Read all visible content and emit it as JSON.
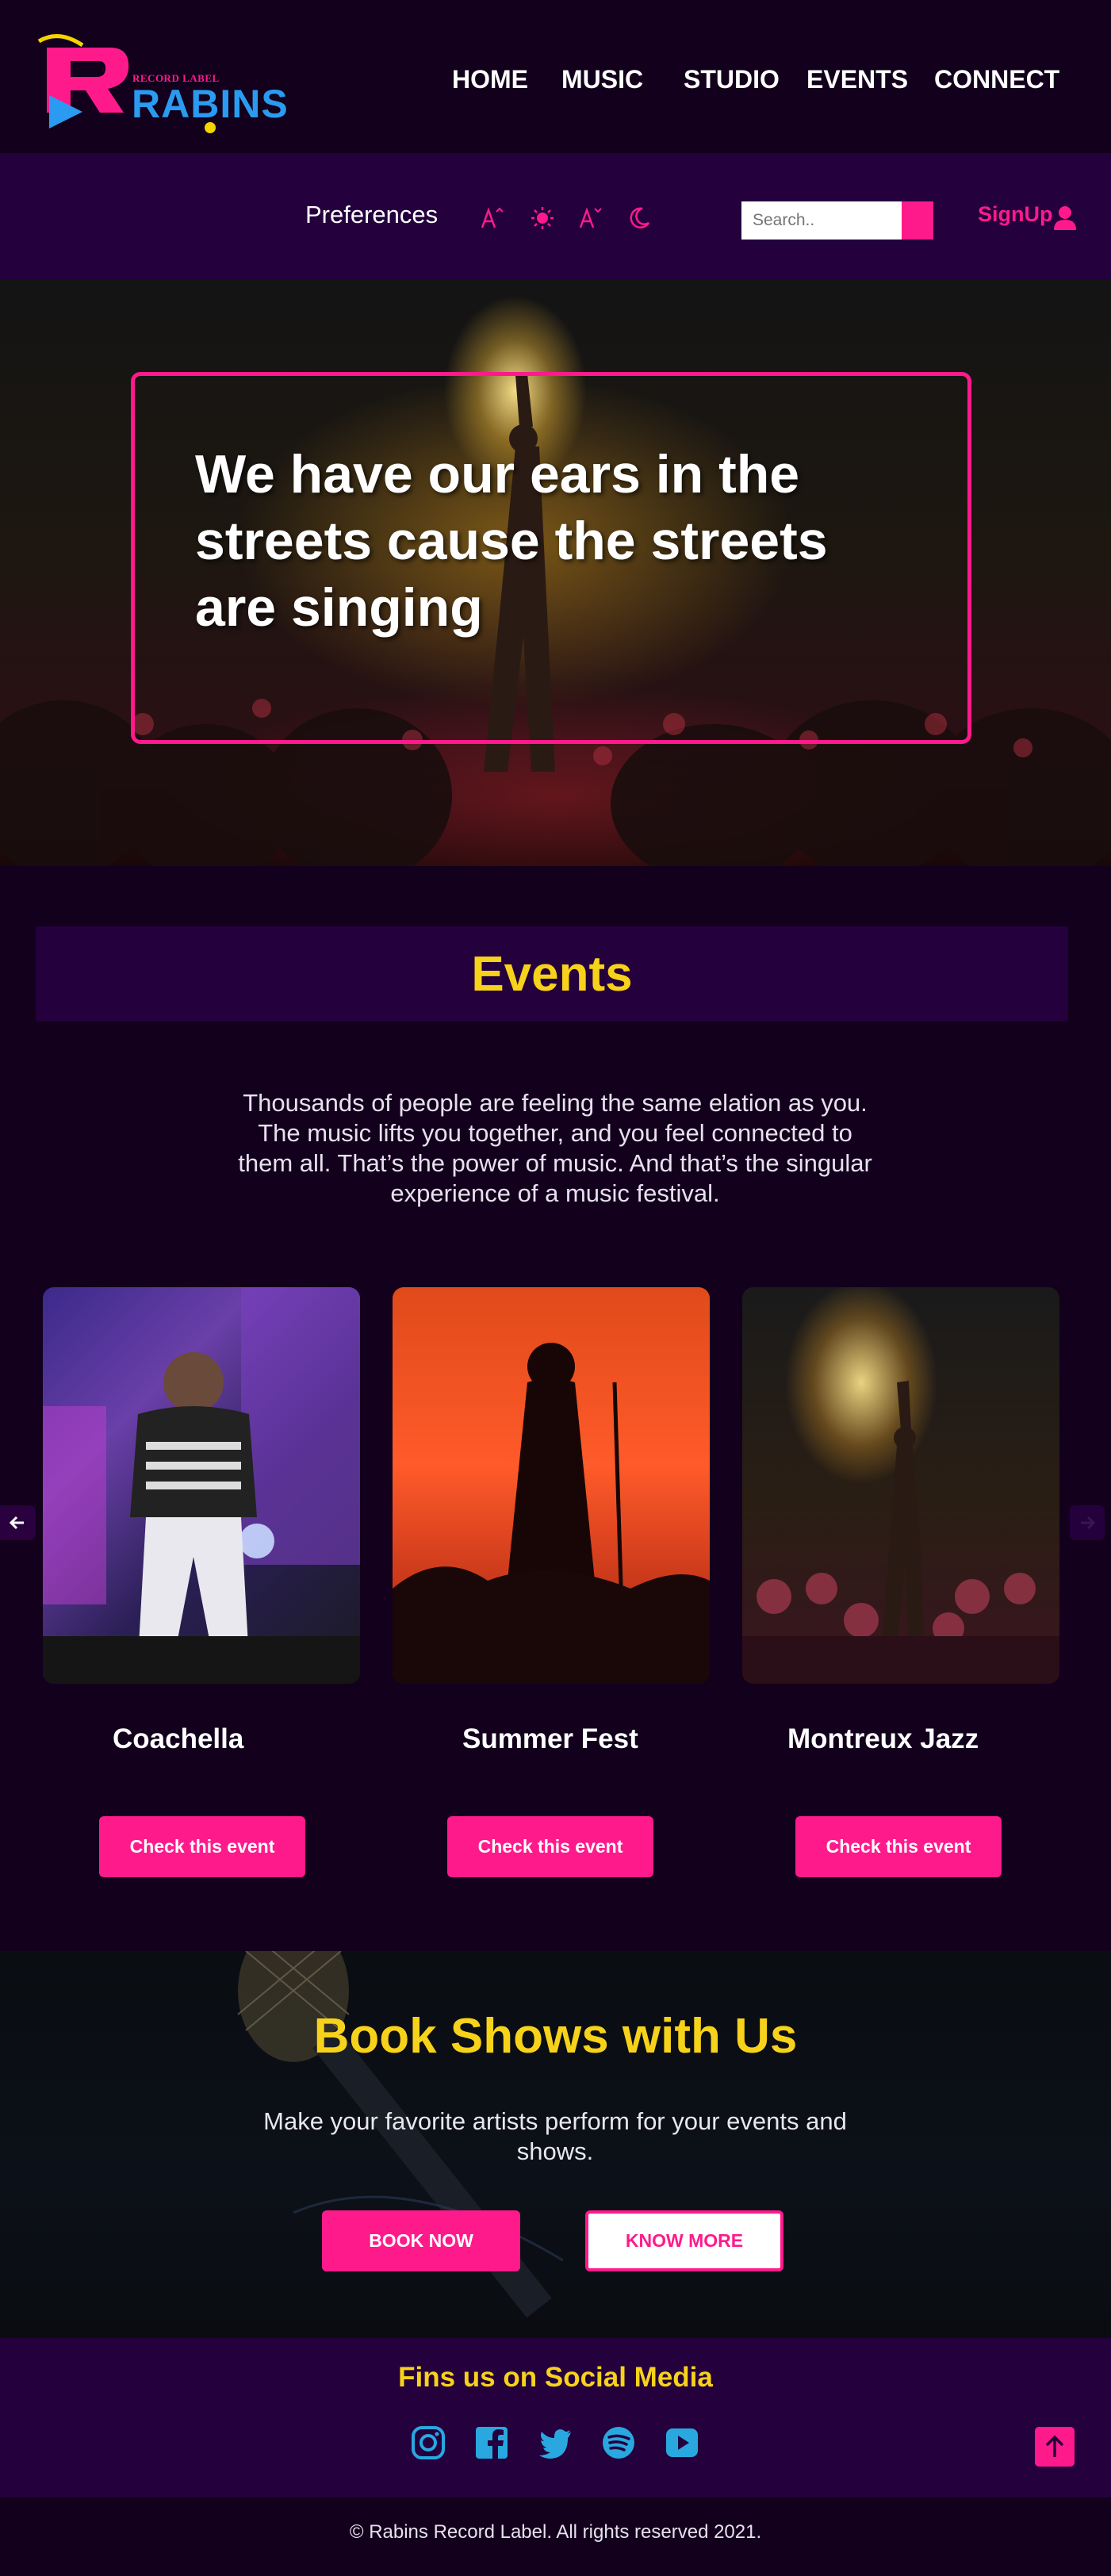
{
  "logo": {
    "small_text": "RECORD LABEL",
    "big_text": "RABINS"
  },
  "nav": {
    "items": [
      "HOME",
      "MUSIC",
      "STUDIO",
      "EVENTS",
      "CONNECT"
    ]
  },
  "preferences": {
    "label": "Preferences",
    "icons": [
      "font-increase-icon",
      "brightness-icon",
      "font-decrease-icon",
      "dark-mode-icon"
    ],
    "search_placeholder": "Search..",
    "signup_label": "SignUp"
  },
  "hero": {
    "title": "We have our ears in the streets cause the streets are singing"
  },
  "events": {
    "title": "Events",
    "description": "Thousands of people are feeling the same elation as you. The music lifts you together, and you feel connected to them all. That’s the power of music. And that’s the singular experience of a music festival.",
    "cards": [
      {
        "title": "Coachella",
        "button": "Check this event"
      },
      {
        "title": "Summer Fest",
        "button": "Check this event"
      },
      {
        "title": "Montreux Jazz",
        "button": "Check this event"
      }
    ]
  },
  "book": {
    "title": "Book Shows with Us",
    "description": "Make your favorite artists perform for your events and shows.",
    "book_button": "BOOK NOW",
    "know_button": "KNOW MORE"
  },
  "social": {
    "title": "Fins us on Social Media",
    "icons": [
      "instagram-icon",
      "facebook-icon",
      "twitter-icon",
      "spotify-icon",
      "youtube-icon"
    ]
  },
  "footer": {
    "copyright": "© Rabins Record Label. All rights reserved 2021."
  },
  "colors": {
    "accent": "#ff1a8c",
    "heading": "#f7d21a",
    "background": "#12001c",
    "panel": "#24003d",
    "social_icon": "#29a8e0"
  }
}
